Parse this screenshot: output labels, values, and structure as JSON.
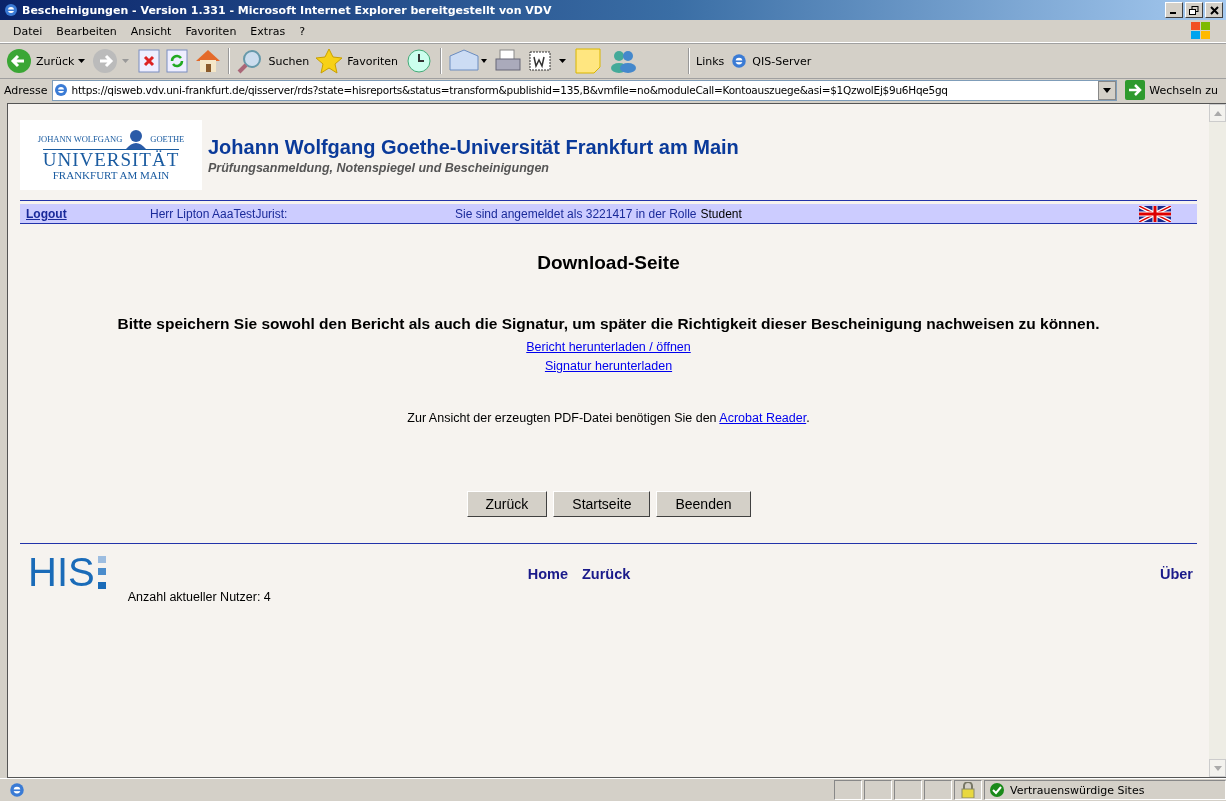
{
  "window": {
    "title": "Bescheinigungen - Version 1.331 - Microsoft Internet Explorer bereitgestellt von VDV"
  },
  "menu": [
    "Datei",
    "Bearbeiten",
    "Ansicht",
    "Favoriten",
    "Extras",
    "?"
  ],
  "toolbar": {
    "back": "Zurück",
    "search": "Suchen",
    "favorites": "Favoriten",
    "links_label": "Links",
    "link": "QIS-Server"
  },
  "address_bar": {
    "label": "Adresse",
    "url": "https://qisweb.vdv.uni-frankfurt.de/qisserver/rds?state=hisreports&status=transform&publishid=135,B&vmfile=no&moduleCall=Kontoauszuege&asi=$1QzwolEj$9u6Hqe5gq",
    "go": "Wechseln zu"
  },
  "header": {
    "logo_top_left": "JOHANN WOLFGANG",
    "logo_top_right": "GOETHE",
    "logo_main": "UNIVERSITÄT",
    "logo_sub": "FRANKFURT AM MAIN",
    "title": "Johann Wolfgang Goethe-Universität Frankfurt am Main",
    "subtitle": "Prüfungsanmeldung, Notenspiegel und Bescheinigungen"
  },
  "user_bar": {
    "logout": "Logout",
    "user": "Herr Lipton AaaTestJurist:",
    "login_info": "Sie sind angemeldet als 3221417 in der Rolle",
    "role": "Student"
  },
  "page": {
    "heading": "Download-Seite",
    "instruction": "Bitte speichern Sie sowohl den Bericht als auch die Signatur, um später die Richtigkeit dieser Bescheinigung nachweisen zu können.",
    "links": [
      "Bericht herunterladen / öffnen",
      "Signatur herunterladen"
    ],
    "reader_text": "Zur Ansicht der erzeugten PDF-Datei benötigen Sie den",
    "reader_link": "Acrobat Reader",
    "reader_end": "."
  },
  "buttons": [
    "Zurück",
    "Startseite",
    "Beenden"
  ],
  "footer": {
    "logo": "HIS",
    "users": "Anzahl aktueller Nutzer: 4",
    "links": [
      "Home",
      "Zurück"
    ],
    "about": "Über"
  },
  "status_bar": {
    "zone": "Vertrauenswürdige Sites"
  }
}
